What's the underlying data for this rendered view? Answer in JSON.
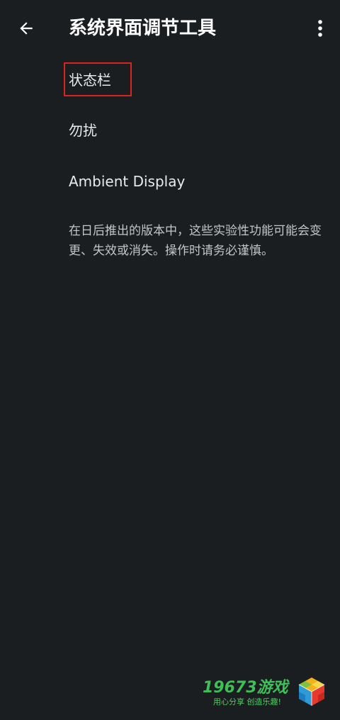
{
  "header": {
    "title": "系统界面调节工具",
    "back_icon": "arrow-back-icon",
    "more_icon": "more-vert-icon"
  },
  "menu": {
    "items": [
      {
        "label": "状态栏",
        "highlighted": true
      },
      {
        "label": "勿扰",
        "highlighted": false
      },
      {
        "label": "Ambient Display",
        "highlighted": false
      }
    ]
  },
  "footer": {
    "note": "在日后推出的版本中，这些实验性功能可能会变更、失效或消失。操作时请务必谨慎。"
  },
  "watermark": {
    "brand_number": "19673",
    "brand_text": "游戏",
    "slogan": "用心分享  创造乐趣!"
  },
  "colors": {
    "background": "#1b1e21",
    "text_primary": "#ffffff",
    "text_secondary": "#c3c5c8",
    "highlight": "#d9261c",
    "watermark_green": "#3fbf58"
  }
}
